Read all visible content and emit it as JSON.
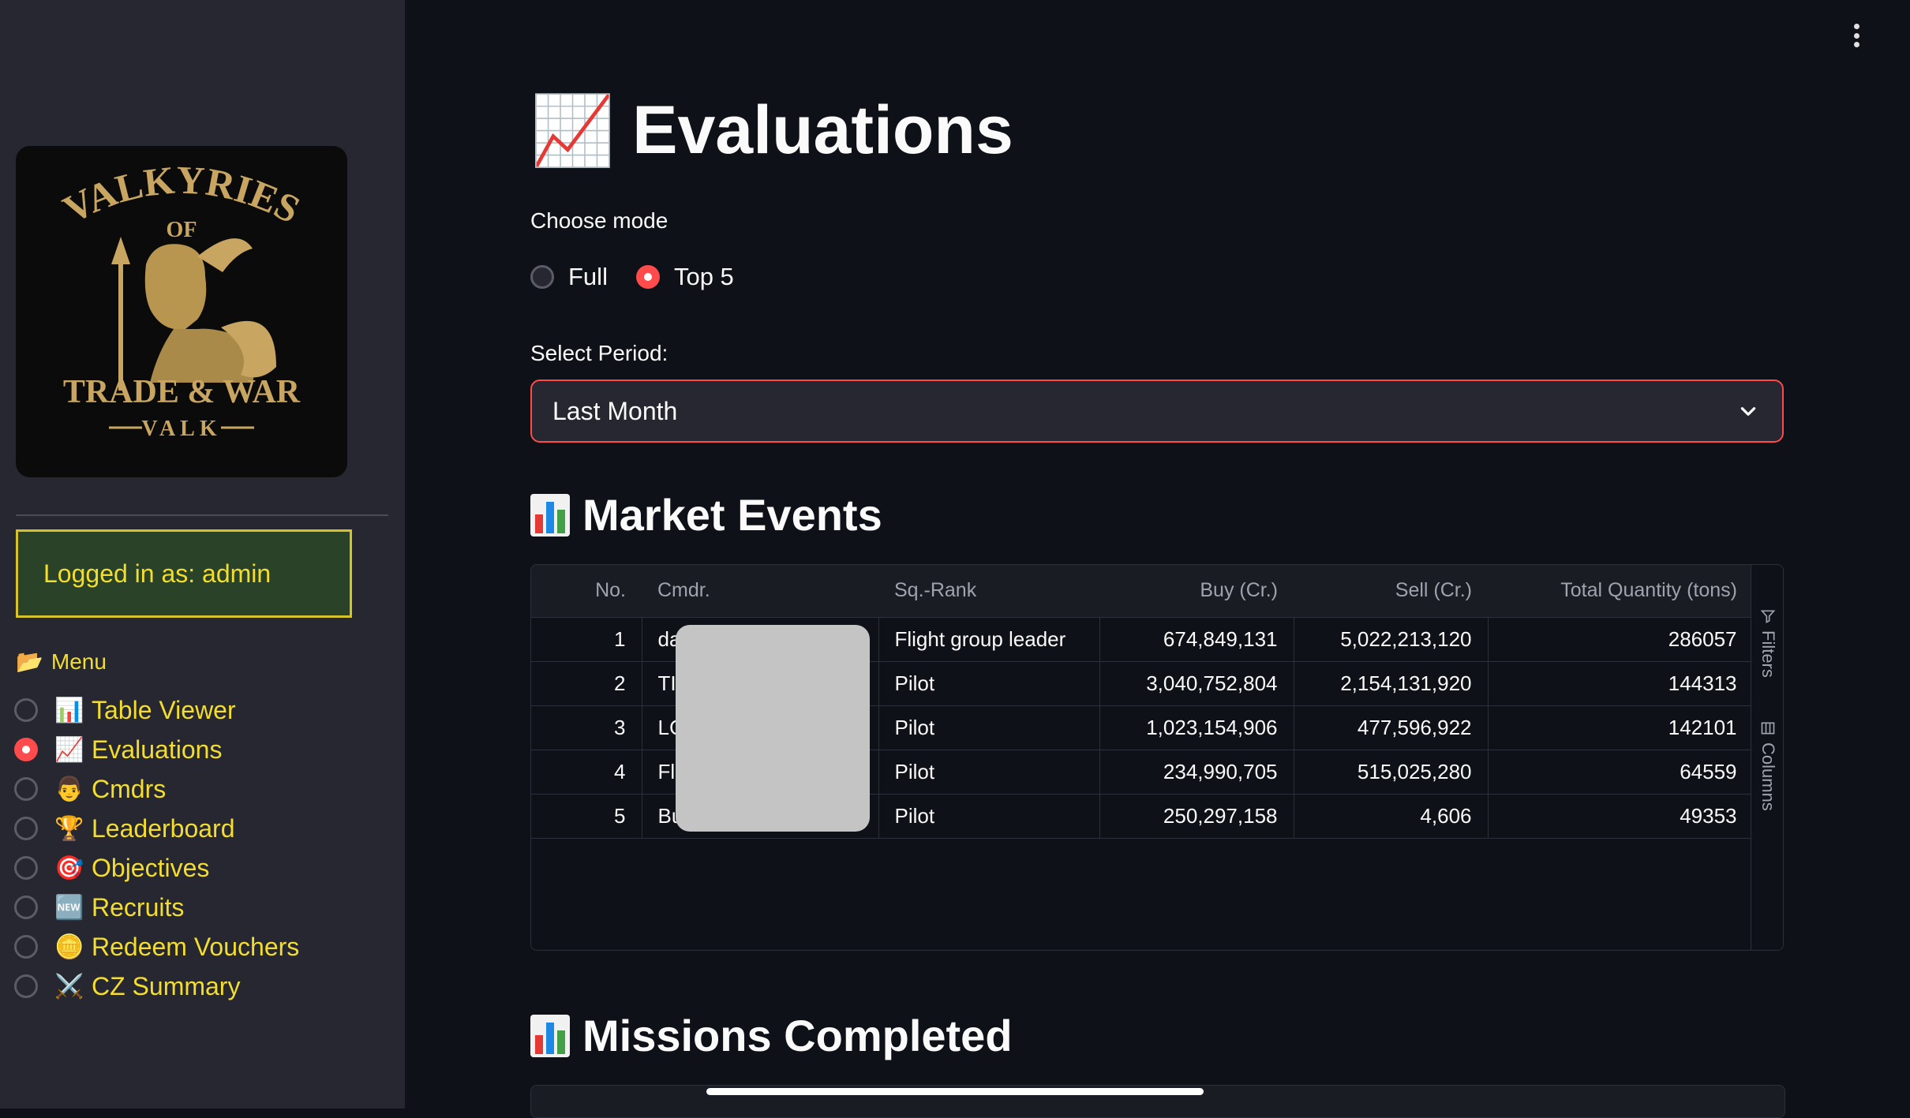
{
  "sidebar": {
    "logo": {
      "line1": "VALKYRIES",
      "line2": "OF",
      "line3": "TRADE & WAR",
      "line4": "VALK"
    },
    "logged_in": "Logged in as: admin",
    "menu_title": "Menu",
    "menu_icon": "folder-icon",
    "items": [
      {
        "emoji": "📊",
        "label": "Table Viewer",
        "checked": false
      },
      {
        "emoji": "📈",
        "label": "Evaluations",
        "checked": true
      },
      {
        "emoji": "👨",
        "label": "Cmdrs",
        "checked": false
      },
      {
        "emoji": "🏆",
        "label": "Leaderboard",
        "checked": false
      },
      {
        "emoji": "🎯",
        "label": "Objectives",
        "checked": false
      },
      {
        "emoji": "🆕",
        "label": "Recruits",
        "checked": false
      },
      {
        "emoji": "🪙",
        "label": "Redeem Vouchers",
        "checked": false
      },
      {
        "emoji": "⚔️",
        "label": "CZ Summary",
        "checked": false
      }
    ]
  },
  "main": {
    "title_emoji": "📈",
    "title": "Evaluations",
    "mode_label": "Choose mode",
    "mode_options": [
      {
        "label": "Full",
        "checked": false
      },
      {
        "label": "Top 5",
        "checked": true
      }
    ],
    "period_label": "Select Period:",
    "period_value": "Last Month",
    "market_title": "Market Events",
    "missions_title": "Missions Completed",
    "grid_side": {
      "filters": "Filters",
      "columns": "Columns"
    },
    "market_table": {
      "headers": [
        "No.",
        "Cmdr.",
        "Sq.-Rank",
        "Buy (Cr.)",
        "Sell (Cr.)",
        "Total Quantity (tons)"
      ],
      "rows": [
        [
          "1",
          "da",
          "Flight group leader",
          "674,849,131",
          "5,022,213,120",
          "286057"
        ],
        [
          "2",
          "TI",
          "Pilot",
          "3,040,752,804",
          "2,154,131,920",
          "144313"
        ],
        [
          "3",
          "LC",
          "Pilot",
          "1,023,154,906",
          "477,596,922",
          "142101"
        ],
        [
          "4",
          "Fl",
          "Pilot",
          "234,990,705",
          "515,025,280",
          "64559"
        ],
        [
          "5",
          "Bu",
          "Pilot",
          "250,297,158",
          "4,606",
          "49353"
        ]
      ]
    }
  },
  "colors": {
    "accent": "#ff4b4b",
    "sidebar_text": "#f3dd2f",
    "background": "#0e1117",
    "sidebar_bg": "#262730"
  }
}
